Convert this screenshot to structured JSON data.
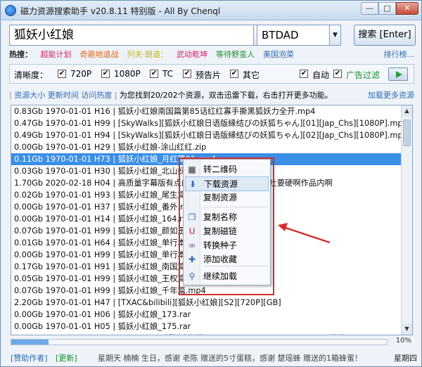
{
  "window": {
    "title": "磁力资源搜索助手 v20.8.11 特别版 - All By Chenql",
    "min_glyph": "—",
    "max_glyph": "□",
    "close_glyph": "✕"
  },
  "search": {
    "query": "狐妖小红娘",
    "engine": "BTDAD",
    "button_label": "搜索 [Enter]",
    "dropdown_glyph": "▼"
  },
  "hot": {
    "label": "热搜：",
    "links": [
      {
        "text": "超能计划",
        "color": "#d81f6e"
      },
      {
        "text": "奇葩地道战",
        "color": "#e0661c"
      },
      {
        "text": "列夫·朗道：",
        "color": "#c9b21a"
      },
      {
        "text": "武动乾坤",
        "color": "#d81f6e"
      },
      {
        "text": "等待野蛮人",
        "color": "#1f8f2e"
      },
      {
        "text": "美国泡菜",
        "color": "#2d6bb5"
      }
    ],
    "ranking": "排行榜..."
  },
  "quality": {
    "label": "清晰度：",
    "options": [
      {
        "text": "720P",
        "checked": true
      },
      {
        "text": "1080P",
        "checked": true
      },
      {
        "text": "TC",
        "checked": true
      },
      {
        "text": "预告片",
        "checked": true
      },
      {
        "text": "其它",
        "checked": true
      }
    ],
    "auto": {
      "text": "自动",
      "checked": true
    },
    "adfilter": {
      "text": "广告过滤",
      "checked": true,
      "color": "#1f8f2e"
    },
    "check_glyph": "✔"
  },
  "info": {
    "sort_size": "资源大小",
    "sort_time": "更新时间",
    "sort_hot": "访问热度",
    "message": "为您找到20/202个资源，双击迅雷下载，右击打开更多功能。",
    "load_more": "加载更多资源"
  },
  "results": [
    "0.83Gb 1970-01-01 H16 | 狐妖小红娘南国篇第85话红红寡手撕黑狐妖力全开.mp4",
    "0.47Gb 1970-01-01 H99 | [SkyWalks][狐妖小红娘日语版縁结びの妖狐ちゃん][01][Jap_Chs][1080P].mp4",
    "0.49Gb 1970-01-01 H94 | [SkyWalks][狐妖小红娘日语版縁结びの妖狐ちゃん][02][Jap_Chs][1080P].mp4",
    "0.00Gb 1970-01-01 H29 | 狐妖小红娘-涂山红红.zip",
    "0.11Gb 1970-01-01 H73 | 狐妖小红娘_月红篇01.mp4",
    "0.03Gb 1970-01-01 H30 | 狐妖小红娘_北山妖帝篇01.mp4",
    "1.70Gb 2020-02-18 H04 | 高质量字幕版有点的…媚骚骚挡不住呕允吞吐要硬啊作品内啊",
    "0.02Gb 1970-01-01 H93 | 狐妖小红娘_尾生篇.mp4",
    "0.00Gb 1970-01-01 H37 | 狐妖小红娘_番外.mp4",
    "0.00Gb 1970-01-01 H14 | 狐妖小红娘_164.rar",
    "0.07Gb 1970-01-01 H99 | 狐妖小红娘_颜如玉篇.mp4",
    "0.01Gb 1970-01-01 H64 | 狐妖小红娘_单行本.zip",
    "0.00Gb 1970-01-01 H99 | 狐妖小红娘_单行本2.zip",
    "0.17Gb 1970-01-01 H91 | 狐妖小红娘_南国篇.mp4",
    "0.05Gb 1970-01-01 H99 | 狐妖小红娘_王权篇.mp4",
    "0.07Gb 1970-01-01 H99 | 狐妖小红娘_千年篇.mp4",
    "2.20Gb 1970-01-01 H47 | [TXAC&bilibili][狐妖小红娘][S2][720P][GB]",
    "0.00Gb 1970-01-01 H06 | 狐妖小红娘_173.rar",
    "0.00Gb 1970-01-01 H05 | 狐妖小红娘_175.rar",
    "2.20Gb 1970-01-01 H99 | [SkyWalks][狐妖小红娘][FoxSpiritMatchmaker][01-13][简体][720P]"
  ],
  "selected_row": 4,
  "context_menu": {
    "items": [
      {
        "label": "转二维码",
        "icon": "qr-code-icon",
        "glyph": "▦",
        "color": "#333"
      },
      {
        "label": "下载资源",
        "icon": "download-icon",
        "glyph": "⬇",
        "color": "#2d6bb5"
      },
      {
        "label": "复制资源",
        "icon": "copy-resource-icon",
        "glyph": "",
        "color": "#333"
      },
      {
        "label": "复制名称",
        "icon": "copy-name-icon",
        "glyph": "❐",
        "color": "#2d6bb5"
      },
      {
        "label": "复制磁链",
        "icon": "magnet-icon",
        "glyph": "U",
        "color": "#c0282c"
      },
      {
        "label": "转换种子",
        "icon": "link-icon",
        "glyph": "∞",
        "color": "#6a3fa0"
      },
      {
        "label": "添加收藏",
        "icon": "favorite-icon",
        "glyph": "✚",
        "color": "#2d6bb5"
      },
      {
        "label": "继续加载",
        "icon": "search-icon",
        "glyph": "⚲",
        "color": "#2d6bb5"
      }
    ]
  },
  "progress": {
    "percent": 10,
    "text": "10%"
  },
  "status": {
    "sponsor": "[赞助作者]",
    "update": "[更新]",
    "marquee": "星期天 楠楠 生日，感谢 老陈 赠送的5寸蛋糕，感谢 楚瑶蜂 赠送的1箱蜂蜜！",
    "weekday": "星期四"
  }
}
